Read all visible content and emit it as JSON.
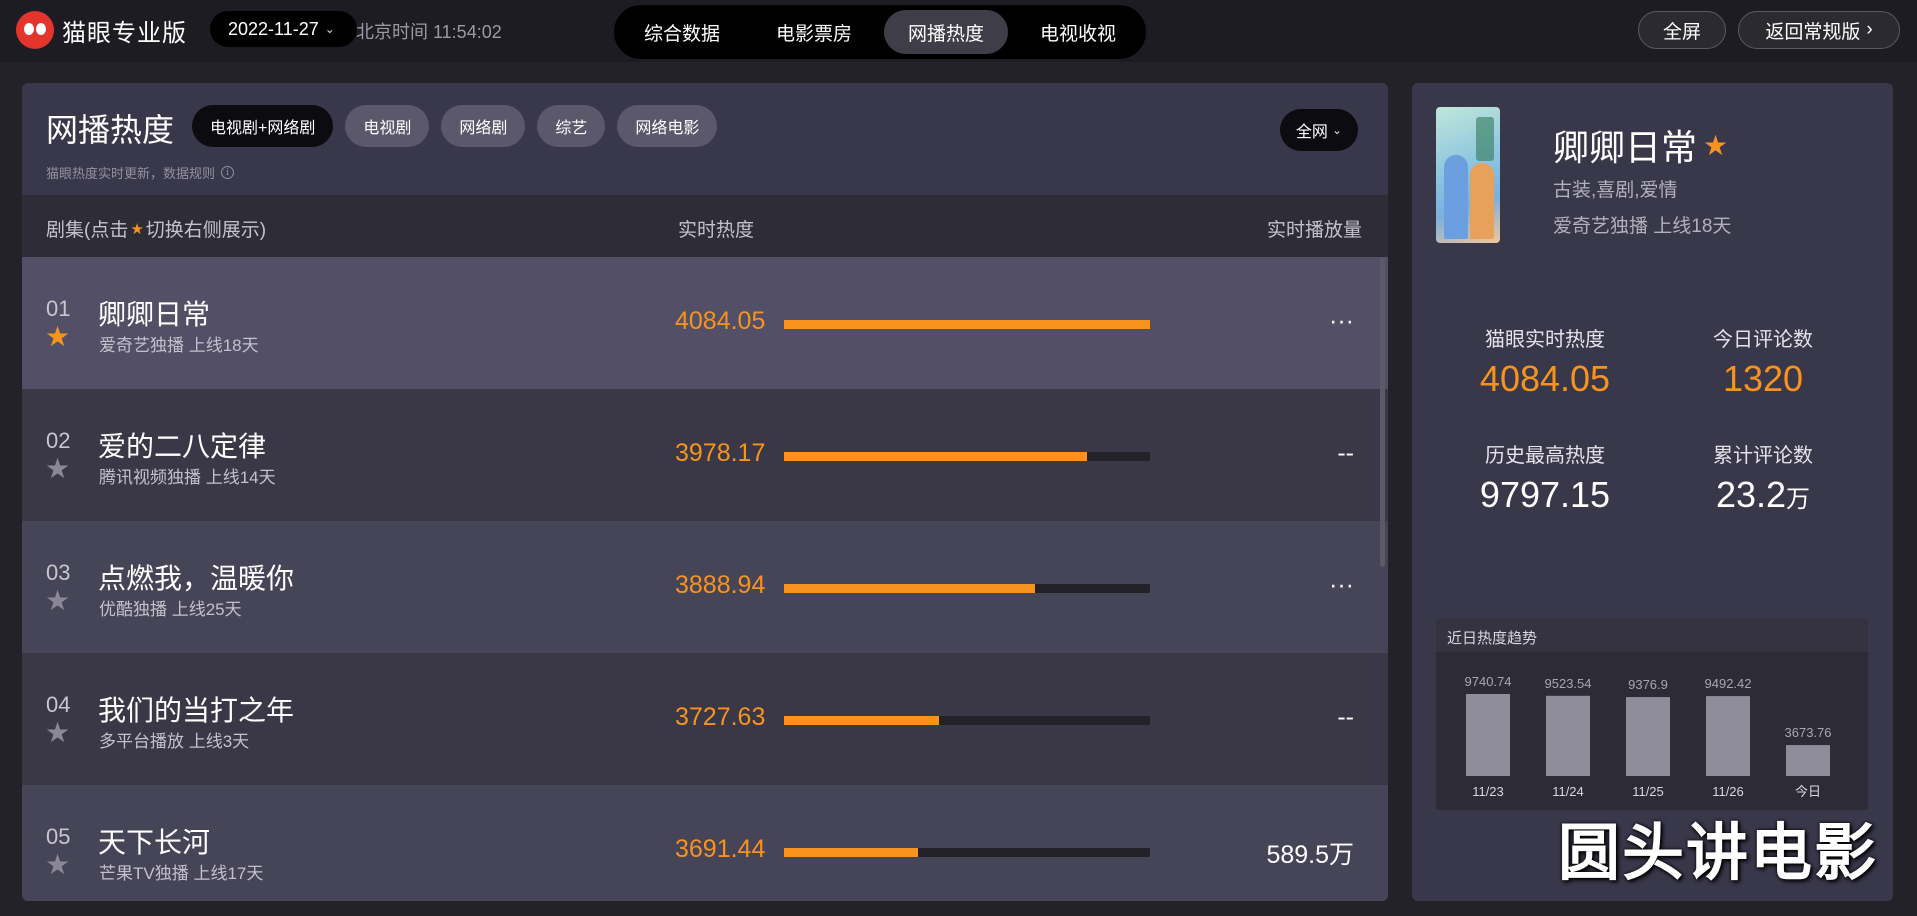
{
  "app": {
    "logo_text": "猫眼专业版",
    "date": "2022-11-27",
    "clock": "北京时间 11:54:02"
  },
  "nav": {
    "tabs": [
      {
        "label": "综合数据",
        "active": false
      },
      {
        "label": "电影票房",
        "active": false
      },
      {
        "label": "网播热度",
        "active": true
      },
      {
        "label": "电视收视",
        "active": false
      }
    ],
    "fullscreen": "全屏",
    "back": "返回常规版"
  },
  "left": {
    "title": "网播热度",
    "chips": [
      {
        "label": "电视剧+网络剧",
        "active": true
      },
      {
        "label": "电视剧",
        "active": false
      },
      {
        "label": "网络剧",
        "active": false
      },
      {
        "label": "综艺",
        "active": false
      },
      {
        "label": "网络电影",
        "active": false
      }
    ],
    "scope": "全网",
    "note": "猫眼热度实时更新，数据规则",
    "columns": {
      "name_prefix": "剧集(点击",
      "name_suffix": "切换右侧展示)",
      "heat": "实时热度",
      "play": "实时播放量"
    },
    "rows": [
      {
        "rank": "01",
        "title": "卿卿日常",
        "meta": "爱奇艺独播  上线18天",
        "heat": "4084.05",
        "heat_num": 4084.05,
        "play": "···",
        "selected": true
      },
      {
        "rank": "02",
        "title": "爱的二八定律",
        "meta": "腾讯视频独播  上线14天",
        "heat": "3978.17",
        "heat_num": 3978.17,
        "play": "--",
        "selected": false
      },
      {
        "rank": "03",
        "title": "点燃我，温暖你",
        "meta": "优酷独播  上线25天",
        "heat": "3888.94",
        "heat_num": 3888.94,
        "play": "···",
        "selected": false
      },
      {
        "rank": "04",
        "title": "我们的当打之年",
        "meta": "多平台播放  上线3天",
        "heat": "3727.63",
        "heat_num": 3727.63,
        "play": "--",
        "selected": false
      },
      {
        "rank": "05",
        "title": "天下长河",
        "meta": "芒果TV独播  上线17天",
        "heat": "3691.44",
        "heat_num": 3691.44,
        "play": "589.5万",
        "selected": false
      }
    ]
  },
  "detail": {
    "title": "卿卿日常",
    "genre": "古装,喜剧,爱情",
    "meta": "爱奇艺独播  上线18天",
    "stats": {
      "realtime_label": "猫眼实时热度",
      "realtime_value": "4084.05",
      "comments_label": "今日评论数",
      "comments_value": "1320",
      "peak_label": "历史最高热度",
      "peak_value": "9797.15",
      "total_label": "累计评论数",
      "total_value": "23.2",
      "total_unit": "万"
    },
    "trend_title": "近日热度趋势"
  },
  "chart_data": {
    "type": "bar",
    "title": "近日热度趋势",
    "categories": [
      "11/23",
      "11/24",
      "11/25",
      "11/26",
      "今日"
    ],
    "values": [
      9740.74,
      9523.54,
      9376.9,
      9492.42,
      3673.76
    ],
    "value_labels": [
      "9740.74",
      "9523.54",
      "9376.9",
      "9492.42",
      "3673.76"
    ],
    "bar_color": "#8e8d99"
  },
  "watermark": "圆头讲电影"
}
